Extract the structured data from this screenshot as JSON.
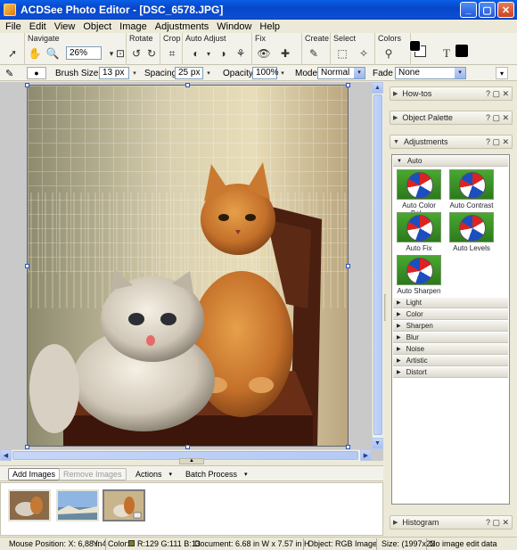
{
  "window": {
    "title": "ACDSee Photo Editor  - [DSC_6578.JPG]"
  },
  "menu": [
    "File",
    "Edit",
    "View",
    "Object",
    "Image",
    "Adjustments",
    "Window",
    "Help"
  ],
  "toolbar": {
    "groups": {
      "navigate": "Navigate",
      "rotate": "Rotate",
      "crop": "Crop",
      "auto_adjust": "Auto Adjust",
      "fix": "Fix",
      "create": "Create",
      "select": "Select",
      "colors": "Colors"
    },
    "zoom": "26%",
    "text_tool": "T"
  },
  "options": {
    "brush_size_label": "Brush Size",
    "brush_size": "13 px",
    "spacing_label": "Spacing",
    "spacing": "25 px",
    "opacity_label": "Opacity",
    "opacity": "100%",
    "mode_label": "Mode",
    "mode": "Normal",
    "fade_label": "Fade",
    "fade": "None"
  },
  "panels": {
    "howtos": "How-tos",
    "object_palette": "Object Palette",
    "adjustments": "Adjustments",
    "histogram": "Histogram",
    "controls": "? ▢ ✕"
  },
  "adjustments": {
    "auto_label": "Auto",
    "auto_items": [
      "Auto Color Bal...",
      "Auto Contrast",
      "Auto Fix",
      "Auto Levels",
      "Auto Sharpen"
    ],
    "categories": [
      "Light",
      "Color",
      "Sharpen",
      "Blur",
      "Noise",
      "Artistic",
      "Distort"
    ]
  },
  "batch": {
    "add_images": "Add Images",
    "remove_images": "Remove Images",
    "actions": "Actions",
    "batch_process": "Batch Process"
  },
  "status": {
    "mouse": "Mouse Position:  X: 6,88 in",
    "mouse_y": "Y: 4",
    "color": "Color:",
    "rgb": "R:129  G:111  B:13",
    "document": "Document:  6.68 in W x 7.57 in H",
    "object": "Object:  RGB Image",
    "size": "Size:  (1997x22",
    "edit": "No image edit data"
  },
  "colors": {
    "accent": "#0a4fd6",
    "fg_swatch": "#000000",
    "bg_swatch": "#ffffff"
  }
}
